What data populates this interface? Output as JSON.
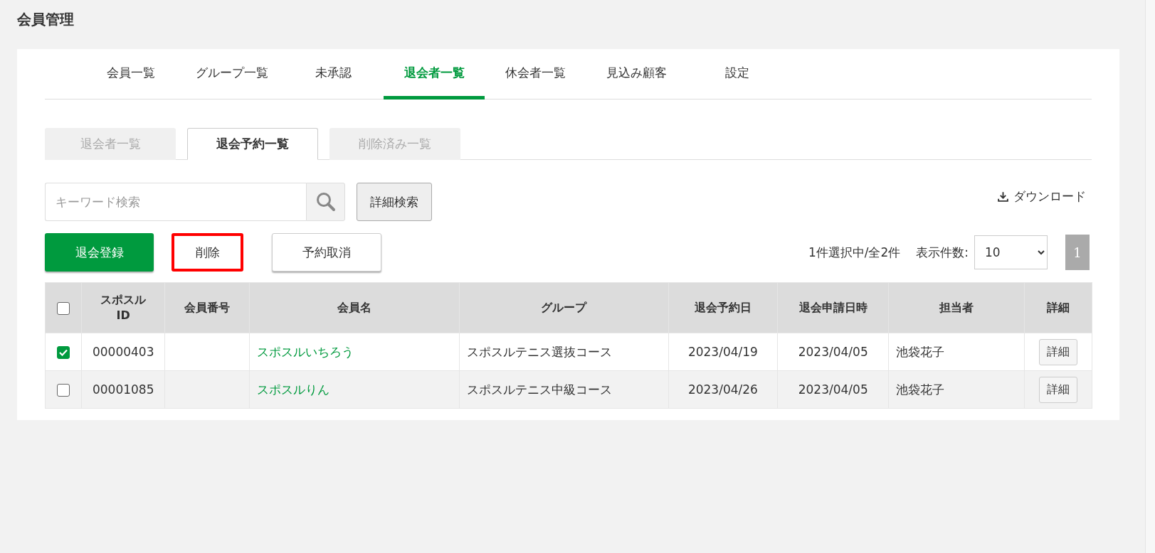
{
  "page_title": "会員管理",
  "tabs": [
    {
      "label": "会員一覧",
      "selected": false
    },
    {
      "label": "グループ一覧",
      "selected": false
    },
    {
      "label": "未承認",
      "selected": false
    },
    {
      "label": "退会者一覧",
      "selected": true
    },
    {
      "label": "休会者一覧",
      "selected": false
    },
    {
      "label": "見込み顧客",
      "selected": false
    },
    {
      "label": "設定",
      "selected": false
    }
  ],
  "subtabs": [
    {
      "label": "退会者一覧",
      "selected": false
    },
    {
      "label": "退会予約一覧",
      "selected": true
    },
    {
      "label": "削除済み一覧",
      "selected": false
    }
  ],
  "search": {
    "placeholder": "キーワード検索"
  },
  "advanced_search_button": "詳細検索",
  "download": "ダウンロード",
  "actions": [
    {
      "label": "退会登録",
      "kind": "primary",
      "highlighted": false
    },
    {
      "label": "削除",
      "kind": "plain",
      "highlighted": true
    },
    {
      "label": "予約取消",
      "kind": "outlined",
      "highlighted": false
    }
  ],
  "selection_summary": "1件選択中/全2件",
  "page_size": {
    "label": "表示件数:",
    "value": "10"
  },
  "pagination": [
    {
      "label": "1",
      "selected": true
    }
  ],
  "table": {
    "select_all_checked": false,
    "columns": [
      "スポスル ID",
      "会員番号",
      "会員名",
      "グループ",
      "退会予約日",
      "退会申請日時",
      "担当者",
      "詳細"
    ],
    "rows": [
      {
        "checked": true,
        "id": "00000403",
        "name": "スポスルいちろう",
        "group": "スポスルテニス選抜コース",
        "withdrawal_date": "2023/04/19",
        "request_datetime": "2023/04/05",
        "staff": "池袋花子",
        "detail_button": "詳細"
      },
      {
        "checked": false,
        "id": "00001085",
        "name": "スポスルりん",
        "group": "スポスルテニス中級コース",
        "withdrawal_date": "2023/04/26",
        "request_datetime": "2023/04/05",
        "staff": "池袋花子",
        "detail_button": "詳細"
      }
    ]
  }
}
